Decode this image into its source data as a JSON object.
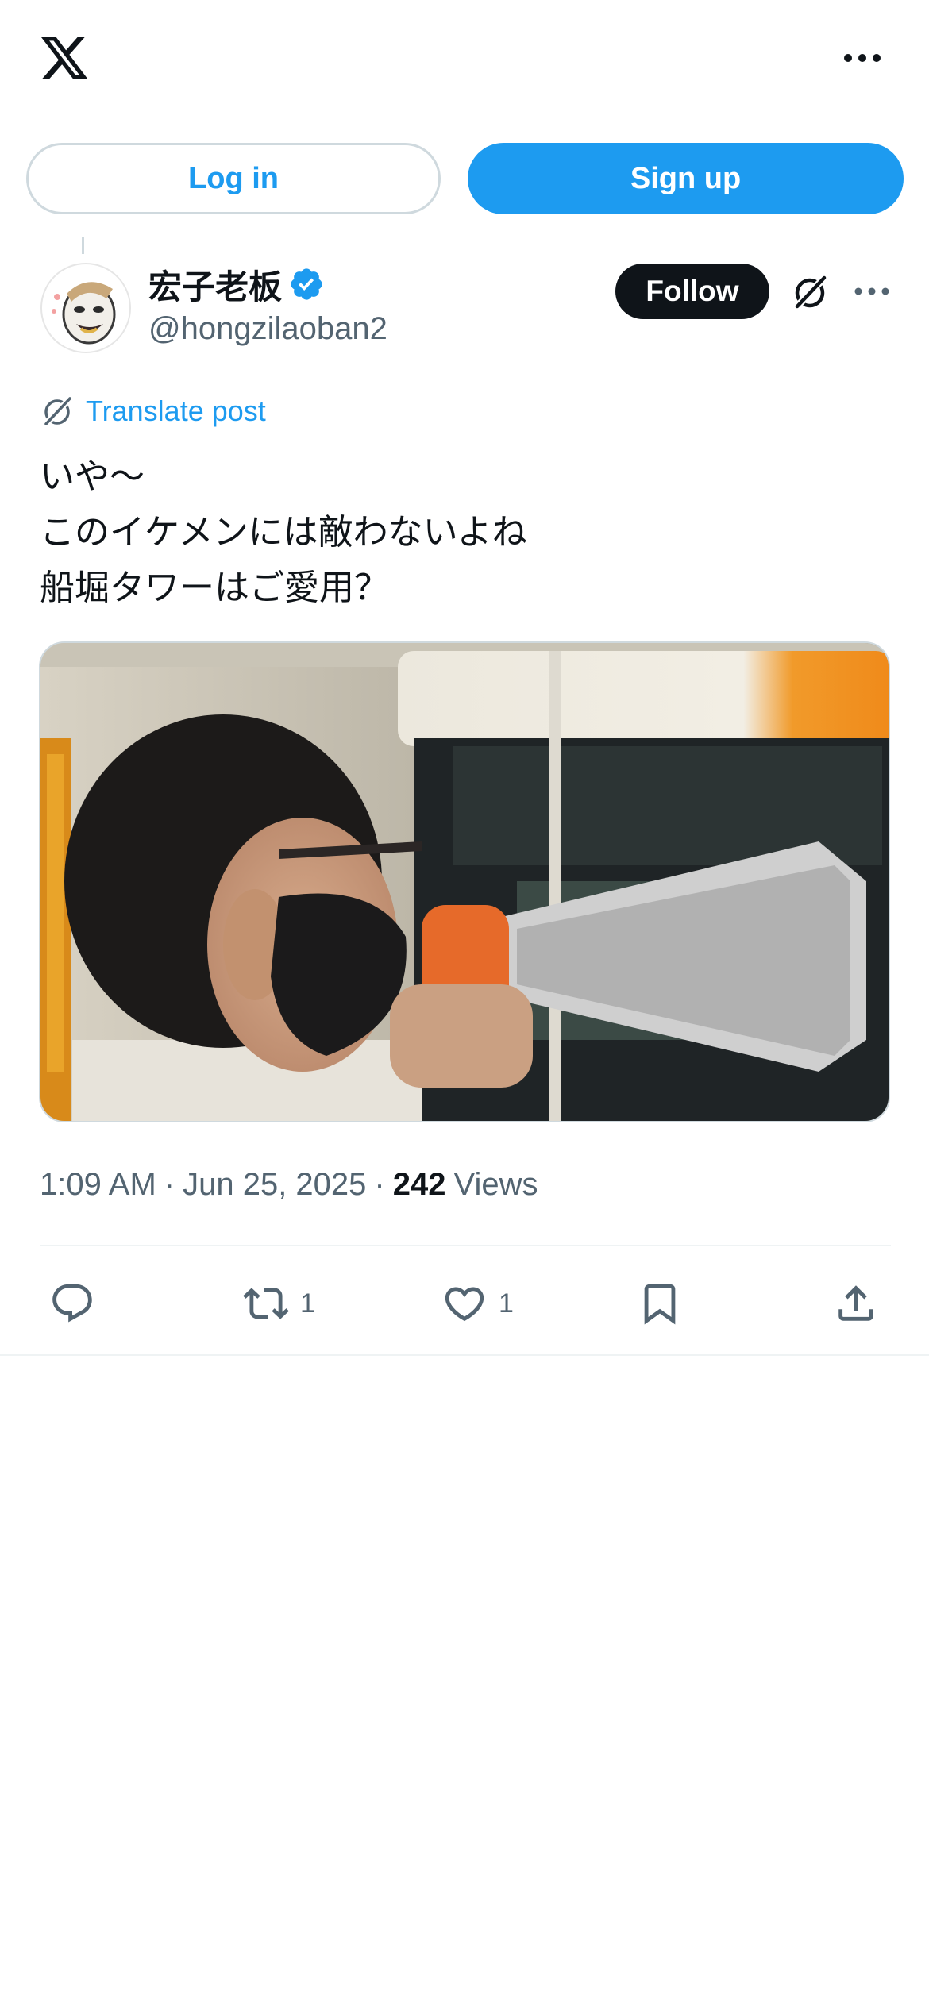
{
  "topbar": {
    "logo_icon": "x-logo-icon",
    "more_icon": "more-horizontal-icon"
  },
  "auth": {
    "login_label": "Log in",
    "signup_label": "Sign up"
  },
  "post": {
    "author": {
      "display_name": "宏子老板",
      "handle": "@hongzilaoban2",
      "verified": true
    },
    "follow_label": "Follow",
    "translate_label": "Translate post",
    "text_lines": [
      "いや〜",
      "このイケメンには敵わないよね",
      "船堀タワーはご愛用？"
    ],
    "media_description": "photo",
    "time": "1:09 AM",
    "date": "Jun 25, 2025",
    "views_count": "242",
    "views_label": "Views",
    "separator": "·",
    "actions": {
      "reply_count": "",
      "repost_count": "1",
      "like_count": "1"
    }
  },
  "colors": {
    "accent": "#1d9bf0",
    "text": "#0f1419",
    "muted": "#536471",
    "border": "#cfd9de"
  }
}
